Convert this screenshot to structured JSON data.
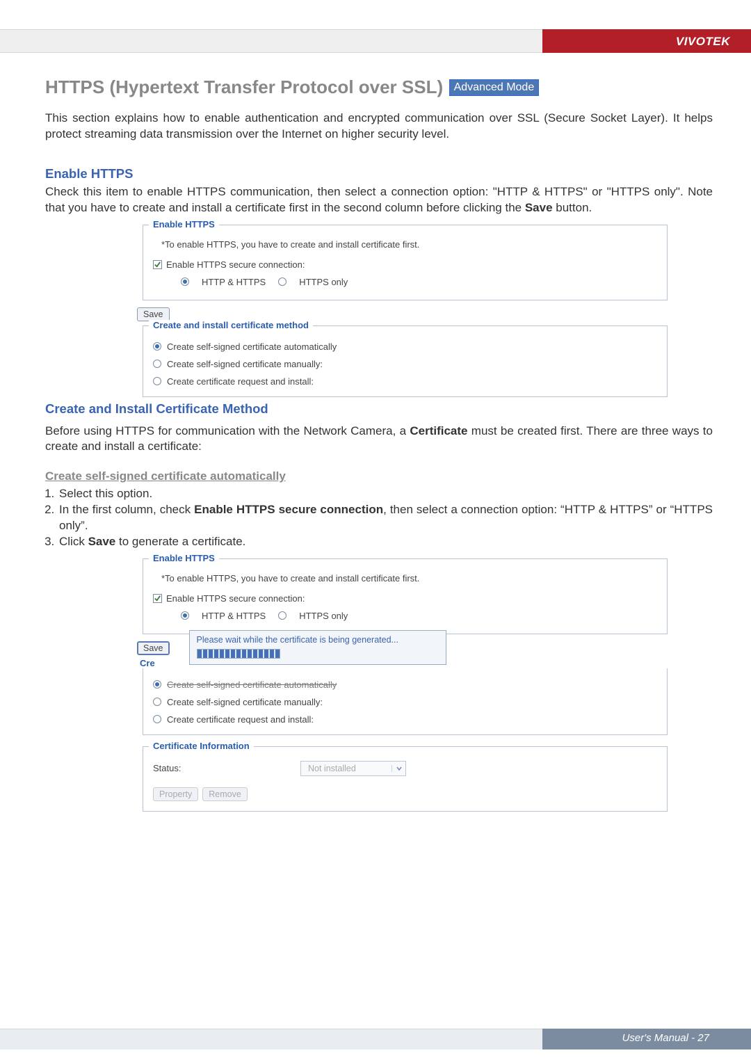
{
  "brand": "VIVOTEK",
  "title": "HTTPS (Hypertext Transfer Protocol over SSL)",
  "badge": "Advanced Mode",
  "intro": "This section explains how to enable authentication and encrypted communication over SSL (Secure Socket Layer). It helps protect streaming data transmission over the Internet on higher security level.",
  "s1_h": "Enable HTTPS",
  "s1_p_a": "Check this item to enable HTTPS communication, then select a connection option: \"HTTP & HTTPS\" or \"HTTPS only\". Note that you have to create and install a certificate first in the second column before clicking the ",
  "s1_p_bold": "Save",
  "s1_p_b": " button.",
  "panel_legend": "Enable HTTPS",
  "panel_note": "*To enable HTTPS, you have to create and install certificate first.",
  "cb_label": "Enable HTTPS secure connection:",
  "radio_http_https": "HTTP & HTTPS",
  "radio_https_only": "HTTPS only",
  "save_btn": "Save",
  "panel2_legend": "Create and install certificate method",
  "cert_opt1": "Create self-signed certificate automatically",
  "cert_opt2": "Create self-signed certificate manually:",
  "cert_opt3": "Create certificate request and install:",
  "s2_h": "Create and Install Certificate Method",
  "s2_p_a": "Before using HTTPS for communication with the Network Camera, a ",
  "s2_p_bold": "Certificate",
  "s2_p_b": " must be created first. There are three ways to create and install a certificate:",
  "s2_sub": "Create self-signed certificate automatically",
  "step1": "Select this option.",
  "step2_a": "In the first column, check ",
  "step2_bold": "Enable HTTPS secure connection",
  "step2_b": ", then select a connection option: “HTTP & HTTPS” or “HTTPS only”.",
  "step3_a": "Click ",
  "step3_bold": "Save",
  "step3_b": " to generate a certificate.",
  "progress_text": "Please wait while the certificate is being generated...",
  "panel3_cre": "Cre",
  "cert_struck": "Create self-signed certificate automatically",
  "panel4_legend": "Certificate Information",
  "status_label": "Status:",
  "status_value": "Not installed",
  "btn_property": "Property",
  "btn_remove": "Remove",
  "footer": "User's Manual - 27"
}
